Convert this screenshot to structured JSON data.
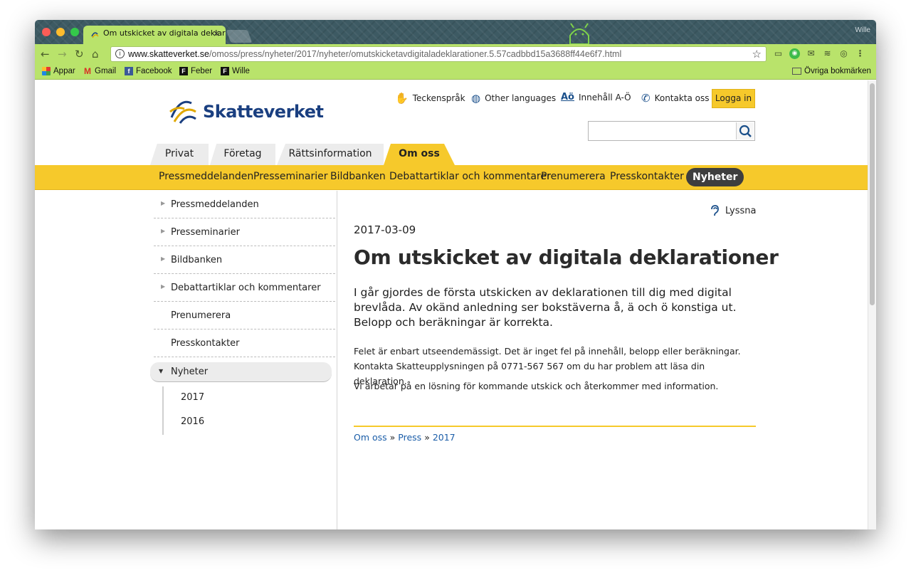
{
  "browser": {
    "tab_title": "Om utskicket av digitala deklar",
    "tab_close": "×",
    "user": "Wille",
    "url_host": "www.skatteverket.se",
    "url_path": "/omoss/press/nyheter/2017/nyheter/omutskicketavdigitaladeklarationer.5.57cadbbd15a3688ff44e6f7.html",
    "bookmarks": [
      "Appar",
      "Gmail",
      "Facebook",
      "Feber",
      "Wille"
    ],
    "other_bookmarks": "Övriga bokmärken"
  },
  "site": {
    "logo_text": "Skatteverket",
    "top_links": [
      "Teckenspråk",
      "Other languages",
      "Innehåll A-Ö",
      "Kontakta oss"
    ],
    "top_link_icons": [
      "sign-language-icon",
      "globe-icon",
      "ao-icon",
      "phone-icon"
    ],
    "login": "Logga in",
    "search_placeholder": "",
    "main_tabs": [
      "Privat",
      "Företag",
      "Rättsinformation",
      "Om oss"
    ],
    "active_main_tab": "Om oss",
    "sub_nav": [
      "Pressmeddelanden",
      "Presseminarier",
      "Bildbanken",
      "Debattartiklar och kommentarer",
      "Prenumerera",
      "Presskontakter"
    ],
    "sub_nav_active": "Nyheter",
    "accent": "#f6c92b",
    "brand_blue": "#1a3f80"
  },
  "sidebar": {
    "items": [
      "Pressmeddelanden",
      "Presseminarier",
      "Bildbanken",
      "Debattartiklar och kommentarer",
      "Prenumerera",
      "Presskontakter"
    ],
    "active": "Nyheter",
    "sub_items": [
      "2017",
      "2016"
    ]
  },
  "article": {
    "listen": "Lyssna",
    "date": "2017-03-09",
    "title": "Om utskicket av digitala deklarationer",
    "lead": "I går gjordes de första utskicken av deklarationen till dig med digital brevlåda. Av okänd anledning ser bokstäverna å, ä och ö konstiga ut. Belopp och beräkningar är korrekta.",
    "body_line1": "Felet är enbart utseendemässigt. Det är inget fel på innehåll, belopp eller beräkningar.",
    "body_line2": "Kontakta Skatteupplysningen på 0771-567 567 om du har problem att läsa din deklaration.",
    "body_para2": "Vi arbetar på en lösning för kommande utskick och återkommer med information.",
    "breadcrumb": [
      "Om oss",
      "Press",
      "2017"
    ],
    "breadcrumb_sep": "»"
  }
}
